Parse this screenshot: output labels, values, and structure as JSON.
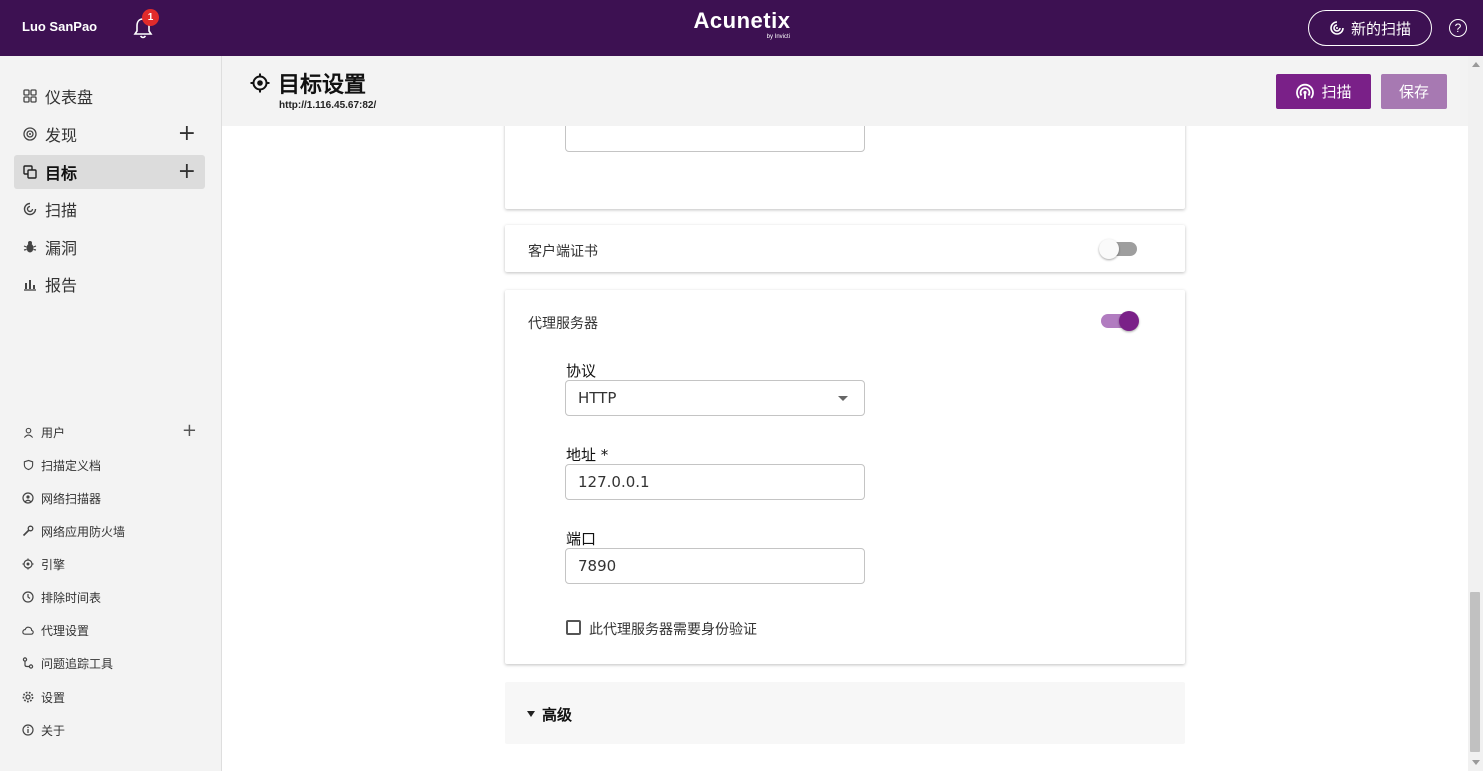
{
  "topbar": {
    "user_name": "Luo SanPao",
    "notification_count": "1",
    "logo": "Acunetix",
    "logo_sub": "by Invicti",
    "new_scan_label": "新的扫描",
    "help_label": "?"
  },
  "sidebar": {
    "nav": [
      {
        "label": "仪表盘",
        "icon": "dashboard-icon"
      },
      {
        "label": "发现",
        "icon": "discovery-icon",
        "has_add": true
      },
      {
        "label": "目标",
        "icon": "targets-icon",
        "has_add": true,
        "active": true
      },
      {
        "label": "扫描",
        "icon": "scans-icon"
      },
      {
        "label": "漏洞",
        "icon": "bug-icon"
      },
      {
        "label": "报告",
        "icon": "reports-icon"
      }
    ],
    "settings": [
      {
        "label": "用户",
        "icon": "user-icon",
        "has_add": true
      },
      {
        "label": "扫描定义档",
        "icon": "shield-icon"
      },
      {
        "label": "网络扫描器",
        "icon": "network-scanner-icon"
      },
      {
        "label": "网络应用防火墙",
        "icon": "wrench-icon"
      },
      {
        "label": "引擎",
        "icon": "engine-icon"
      },
      {
        "label": "排除时间表",
        "icon": "clock-icon"
      },
      {
        "label": "代理设置",
        "icon": "cloud-icon"
      },
      {
        "label": "问题追踪工具",
        "icon": "issue-tracker-icon"
      },
      {
        "label": "设置",
        "icon": "gear-icon"
      },
      {
        "label": "关于",
        "icon": "info-icon"
      }
    ],
    "plus": "+"
  },
  "header": {
    "title": "目标设置",
    "url": "http://1.116.45.67:82/",
    "scan_label": "扫描",
    "save_label": "保存"
  },
  "client_cert": {
    "title": "客户端证书",
    "enabled": false
  },
  "proxy": {
    "title": "代理服务器",
    "enabled": true,
    "protocol_label": "协议",
    "protocol_value": "HTTP",
    "address_label": "地址 *",
    "address_value": "127.0.0.1",
    "port_label": "端口",
    "port_value": "7890",
    "auth_label": "此代理服务器需要身份验证",
    "auth_checked": false
  },
  "advanced": {
    "label": "高级"
  },
  "colors": {
    "topbar": "#3d1152",
    "accent": "#7a2088",
    "save_disabled": "#a779b2",
    "toggle_track_on": "#b17cc0"
  }
}
